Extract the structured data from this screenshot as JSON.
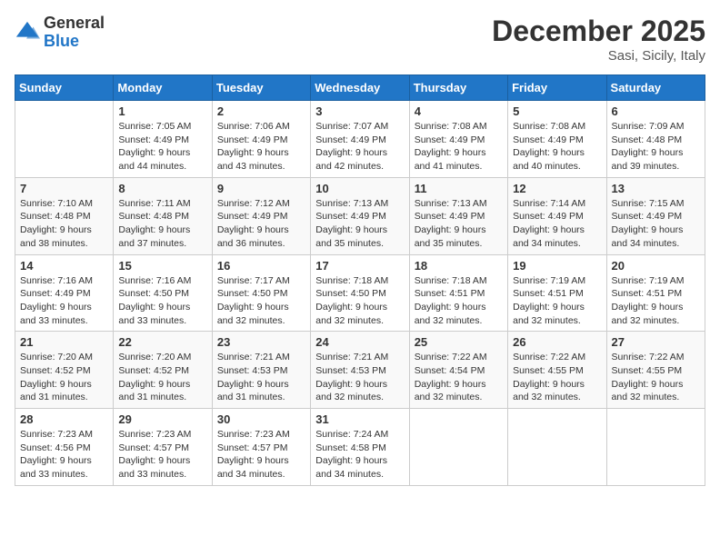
{
  "logo": {
    "general": "General",
    "blue": "Blue"
  },
  "title": "December 2025",
  "location": "Sasi, Sicily, Italy",
  "weekdays": [
    "Sunday",
    "Monday",
    "Tuesday",
    "Wednesday",
    "Thursday",
    "Friday",
    "Saturday"
  ],
  "weeks": [
    [
      {
        "day": "",
        "info": ""
      },
      {
        "day": "1",
        "info": "Sunrise: 7:05 AM\nSunset: 4:49 PM\nDaylight: 9 hours\nand 44 minutes."
      },
      {
        "day": "2",
        "info": "Sunrise: 7:06 AM\nSunset: 4:49 PM\nDaylight: 9 hours\nand 43 minutes."
      },
      {
        "day": "3",
        "info": "Sunrise: 7:07 AM\nSunset: 4:49 PM\nDaylight: 9 hours\nand 42 minutes."
      },
      {
        "day": "4",
        "info": "Sunrise: 7:08 AM\nSunset: 4:49 PM\nDaylight: 9 hours\nand 41 minutes."
      },
      {
        "day": "5",
        "info": "Sunrise: 7:08 AM\nSunset: 4:49 PM\nDaylight: 9 hours\nand 40 minutes."
      },
      {
        "day": "6",
        "info": "Sunrise: 7:09 AM\nSunset: 4:48 PM\nDaylight: 9 hours\nand 39 minutes."
      }
    ],
    [
      {
        "day": "7",
        "info": "Sunrise: 7:10 AM\nSunset: 4:48 PM\nDaylight: 9 hours\nand 38 minutes."
      },
      {
        "day": "8",
        "info": "Sunrise: 7:11 AM\nSunset: 4:48 PM\nDaylight: 9 hours\nand 37 minutes."
      },
      {
        "day": "9",
        "info": "Sunrise: 7:12 AM\nSunset: 4:49 PM\nDaylight: 9 hours\nand 36 minutes."
      },
      {
        "day": "10",
        "info": "Sunrise: 7:13 AM\nSunset: 4:49 PM\nDaylight: 9 hours\nand 35 minutes."
      },
      {
        "day": "11",
        "info": "Sunrise: 7:13 AM\nSunset: 4:49 PM\nDaylight: 9 hours\nand 35 minutes."
      },
      {
        "day": "12",
        "info": "Sunrise: 7:14 AM\nSunset: 4:49 PM\nDaylight: 9 hours\nand 34 minutes."
      },
      {
        "day": "13",
        "info": "Sunrise: 7:15 AM\nSunset: 4:49 PM\nDaylight: 9 hours\nand 34 minutes."
      }
    ],
    [
      {
        "day": "14",
        "info": "Sunrise: 7:16 AM\nSunset: 4:49 PM\nDaylight: 9 hours\nand 33 minutes."
      },
      {
        "day": "15",
        "info": "Sunrise: 7:16 AM\nSunset: 4:50 PM\nDaylight: 9 hours\nand 33 minutes."
      },
      {
        "day": "16",
        "info": "Sunrise: 7:17 AM\nSunset: 4:50 PM\nDaylight: 9 hours\nand 32 minutes."
      },
      {
        "day": "17",
        "info": "Sunrise: 7:18 AM\nSunset: 4:50 PM\nDaylight: 9 hours\nand 32 minutes."
      },
      {
        "day": "18",
        "info": "Sunrise: 7:18 AM\nSunset: 4:51 PM\nDaylight: 9 hours\nand 32 minutes."
      },
      {
        "day": "19",
        "info": "Sunrise: 7:19 AM\nSunset: 4:51 PM\nDaylight: 9 hours\nand 32 minutes."
      },
      {
        "day": "20",
        "info": "Sunrise: 7:19 AM\nSunset: 4:51 PM\nDaylight: 9 hours\nand 32 minutes."
      }
    ],
    [
      {
        "day": "21",
        "info": "Sunrise: 7:20 AM\nSunset: 4:52 PM\nDaylight: 9 hours\nand 31 minutes."
      },
      {
        "day": "22",
        "info": "Sunrise: 7:20 AM\nSunset: 4:52 PM\nDaylight: 9 hours\nand 31 minutes."
      },
      {
        "day": "23",
        "info": "Sunrise: 7:21 AM\nSunset: 4:53 PM\nDaylight: 9 hours\nand 31 minutes."
      },
      {
        "day": "24",
        "info": "Sunrise: 7:21 AM\nSunset: 4:53 PM\nDaylight: 9 hours\nand 32 minutes."
      },
      {
        "day": "25",
        "info": "Sunrise: 7:22 AM\nSunset: 4:54 PM\nDaylight: 9 hours\nand 32 minutes."
      },
      {
        "day": "26",
        "info": "Sunrise: 7:22 AM\nSunset: 4:55 PM\nDaylight: 9 hours\nand 32 minutes."
      },
      {
        "day": "27",
        "info": "Sunrise: 7:22 AM\nSunset: 4:55 PM\nDaylight: 9 hours\nand 32 minutes."
      }
    ],
    [
      {
        "day": "28",
        "info": "Sunrise: 7:23 AM\nSunset: 4:56 PM\nDaylight: 9 hours\nand 33 minutes."
      },
      {
        "day": "29",
        "info": "Sunrise: 7:23 AM\nSunset: 4:57 PM\nDaylight: 9 hours\nand 33 minutes."
      },
      {
        "day": "30",
        "info": "Sunrise: 7:23 AM\nSunset: 4:57 PM\nDaylight: 9 hours\nand 34 minutes."
      },
      {
        "day": "31",
        "info": "Sunrise: 7:24 AM\nSunset: 4:58 PM\nDaylight: 9 hours\nand 34 minutes."
      },
      {
        "day": "",
        "info": ""
      },
      {
        "day": "",
        "info": ""
      },
      {
        "day": "",
        "info": ""
      }
    ]
  ]
}
